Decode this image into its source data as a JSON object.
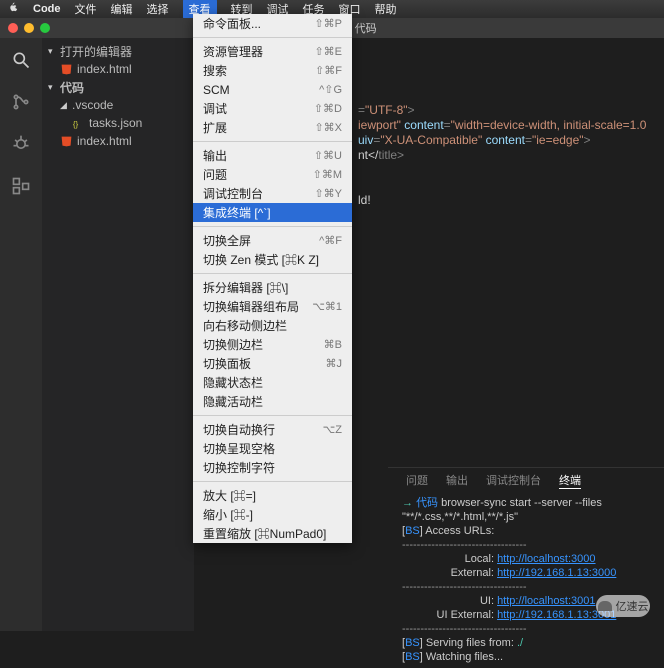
{
  "menubar": {
    "app": "Code",
    "items": [
      "文件",
      "编辑",
      "选择",
      "查看",
      "转到",
      "调试",
      "任务",
      "窗口",
      "帮助"
    ],
    "active": 3
  },
  "titlebar": "index.html — 代码",
  "sidebar": {
    "section1": "打开的编辑器",
    "openFile": "index.html",
    "section2": "代码",
    "folder": ".vscode",
    "tasksFile": "tasks.json",
    "rootFile": "index.html"
  },
  "menu": {
    "g1": [
      {
        "l": "命令面板...",
        "s": "⇧⌘P"
      }
    ],
    "g2": [
      {
        "l": "资源管理器",
        "s": "⇧⌘E"
      },
      {
        "l": "搜索",
        "s": "⇧⌘F"
      },
      {
        "l": "SCM",
        "s": "^⇧G"
      },
      {
        "l": "调试",
        "s": "⇧⌘D"
      },
      {
        "l": "扩展",
        "s": "⇧⌘X"
      }
    ],
    "g3": [
      {
        "l": "输出",
        "s": "⇧⌘U"
      },
      {
        "l": "问题",
        "s": "⇧⌘M"
      },
      {
        "l": "调试控制台",
        "s": "⇧⌘Y"
      },
      {
        "l": "集成终端 [^`]",
        "s": "",
        "hi": true
      }
    ],
    "g4": [
      {
        "l": "切换全屏",
        "s": "^⌘F"
      },
      {
        "l": "切换 Zen 模式 [⌘K Z]",
        "s": ""
      }
    ],
    "g5": [
      {
        "l": "拆分编辑器 [⌘\\]",
        "s": ""
      },
      {
        "l": "切换编辑器组布局",
        "s": "⌥⌘1"
      },
      {
        "l": "向右移动侧边栏",
        "s": ""
      },
      {
        "l": "切换侧边栏",
        "s": "⌘B"
      },
      {
        "l": "切换面板",
        "s": "⌘J"
      },
      {
        "l": "隐藏状态栏",
        "s": ""
      },
      {
        "l": "隐藏活动栏",
        "s": ""
      }
    ],
    "g6": [
      {
        "l": "切换自动换行",
        "s": "⌥Z"
      },
      {
        "l": "切换呈现空格",
        "s": ""
      },
      {
        "l": "切换控制字符",
        "s": ""
      }
    ],
    "g7": [
      {
        "l": "放大 [⌘=]",
        "s": ""
      },
      {
        "l": "缩小 [⌘-]",
        "s": ""
      },
      {
        "l": "重置缩放 [⌘NumPad0]",
        "s": ""
      }
    ]
  },
  "code": {
    "l1a": "=",
    "l1b": "\"UTF-8\"",
    "l1c": ">",
    "l2a": "iewport\"",
    "l2b": " content",
    "l2c": "=",
    "l2d": "\"width=device-width, initial-scale=1.0",
    "l3a": "uiv",
    "l3b": "=",
    "l3c": "\"X-UA-Compatible\"",
    "l3d": " content",
    "l3e": "=",
    "l3f": "\"ie=edge\"",
    "l3g": ">",
    "l4a": "nt</",
    "l4b": "title",
    "l4c": ">",
    "l5": "ld!"
  },
  "panel": {
    "tabs": [
      "问题",
      "输出",
      "调试控制台",
      "终端"
    ],
    "active": 3,
    "prompt_arrow": "→",
    "prompt_dir": "代码",
    "cmd": "browser-sync start --server --files \"**/*.css,**/*.html,**/*.js\"",
    "bs": "BS",
    "access": "] Access URLs:",
    "dash": " ----------------------------------",
    "local_l": "Local:",
    "local_v": "http://localhost:3000",
    "ext_l": "External:",
    "ext_v": "http://192.168.1.13:3000",
    "ui_l": "UI:",
    "ui_v": "http://localhost:3001",
    "uie_l": "UI External:",
    "uie_v": "http://192.168.1.13:3001",
    "serve": "] Serving files from: ",
    "serve_v": "./",
    "watch": "] Watching files..."
  },
  "watermark": "亿速云"
}
